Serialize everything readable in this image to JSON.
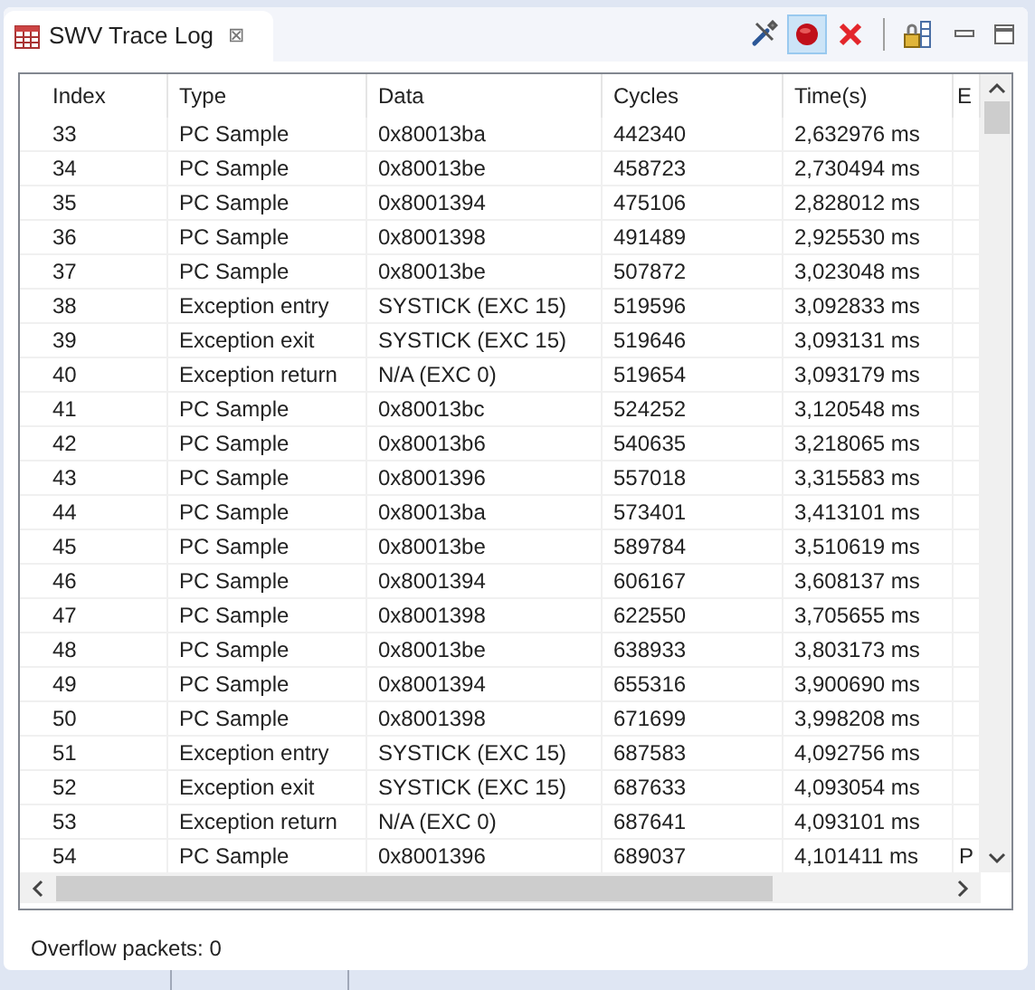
{
  "tab": {
    "title": "SWV Trace Log",
    "close": "⊠"
  },
  "toolbar": [
    {
      "kind": "tools",
      "pressed": false
    },
    {
      "kind": "record",
      "pressed": true
    },
    {
      "kind": "remove",
      "pressed": false
    },
    {
      "kind": "lock",
      "pressed": false
    }
  ],
  "table": {
    "columns": [
      "Index",
      "Type",
      "Data",
      "Cycles",
      "Time(s)",
      "E"
    ],
    "rows": [
      {
        "index": "33",
        "type": "PC Sample",
        "data": "0x80013ba",
        "cycles": "442340",
        "time": "2,632976 ms"
      },
      {
        "index": "34",
        "type": "PC Sample",
        "data": "0x80013be",
        "cycles": "458723",
        "time": "2,730494 ms"
      },
      {
        "index": "35",
        "type": "PC Sample",
        "data": "0x8001394",
        "cycles": "475106",
        "time": "2,828012 ms"
      },
      {
        "index": "36",
        "type": "PC Sample",
        "data": "0x8001398",
        "cycles": "491489",
        "time": "2,925530 ms"
      },
      {
        "index": "37",
        "type": "PC Sample",
        "data": "0x80013be",
        "cycles": "507872",
        "time": "3,023048 ms"
      },
      {
        "index": "38",
        "type": "Exception entry",
        "data": "SYSTICK (EXC 15)",
        "cycles": "519596",
        "time": "3,092833 ms"
      },
      {
        "index": "39",
        "type": "Exception exit",
        "data": "SYSTICK (EXC 15)",
        "cycles": "519646",
        "time": "3,093131 ms"
      },
      {
        "index": "40",
        "type": "Exception return",
        "data": "N/A (EXC 0)",
        "cycles": "519654",
        "time": "3,093179 ms"
      },
      {
        "index": "41",
        "type": "PC Sample",
        "data": "0x80013bc",
        "cycles": "524252",
        "time": "3,120548 ms"
      },
      {
        "index": "42",
        "type": "PC Sample",
        "data": "0x80013b6",
        "cycles": "540635",
        "time": "3,218065 ms"
      },
      {
        "index": "43",
        "type": "PC Sample",
        "data": "0x8001396",
        "cycles": "557018",
        "time": "3,315583 ms"
      },
      {
        "index": "44",
        "type": "PC Sample",
        "data": "0x80013ba",
        "cycles": "573401",
        "time": "3,413101 ms"
      },
      {
        "index": "45",
        "type": "PC Sample",
        "data": "0x80013be",
        "cycles": "589784",
        "time": "3,510619 ms"
      },
      {
        "index": "46",
        "type": "PC Sample",
        "data": "0x8001394",
        "cycles": "606167",
        "time": "3,608137 ms"
      },
      {
        "index": "47",
        "type": "PC Sample",
        "data": "0x8001398",
        "cycles": "622550",
        "time": "3,705655 ms"
      },
      {
        "index": "48",
        "type": "PC Sample",
        "data": "0x80013be",
        "cycles": "638933",
        "time": "3,803173 ms"
      },
      {
        "index": "49",
        "type": "PC Sample",
        "data": "0x8001394",
        "cycles": "655316",
        "time": "3,900690 ms"
      },
      {
        "index": "50",
        "type": "PC Sample",
        "data": "0x8001398",
        "cycles": "671699",
        "time": "3,998208 ms"
      },
      {
        "index": "51",
        "type": "Exception entry",
        "data": "SYSTICK (EXC 15)",
        "cycles": "687583",
        "time": "4,092756 ms"
      },
      {
        "index": "52",
        "type": "Exception exit",
        "data": "SYSTICK (EXC 15)",
        "cycles": "687633",
        "time": "4,093054 ms"
      },
      {
        "index": "53",
        "type": "Exception return",
        "data": "N/A (EXC 0)",
        "cycles": "687641",
        "time": "4,093101 ms"
      },
      {
        "index": "54",
        "type": "PC Sample",
        "data": "0x8001396",
        "cycles": "689037",
        "time": "4,101411 ms",
        "column_6": "P"
      }
    ]
  },
  "footer": {
    "overflow": "Overflow packets: 0"
  }
}
